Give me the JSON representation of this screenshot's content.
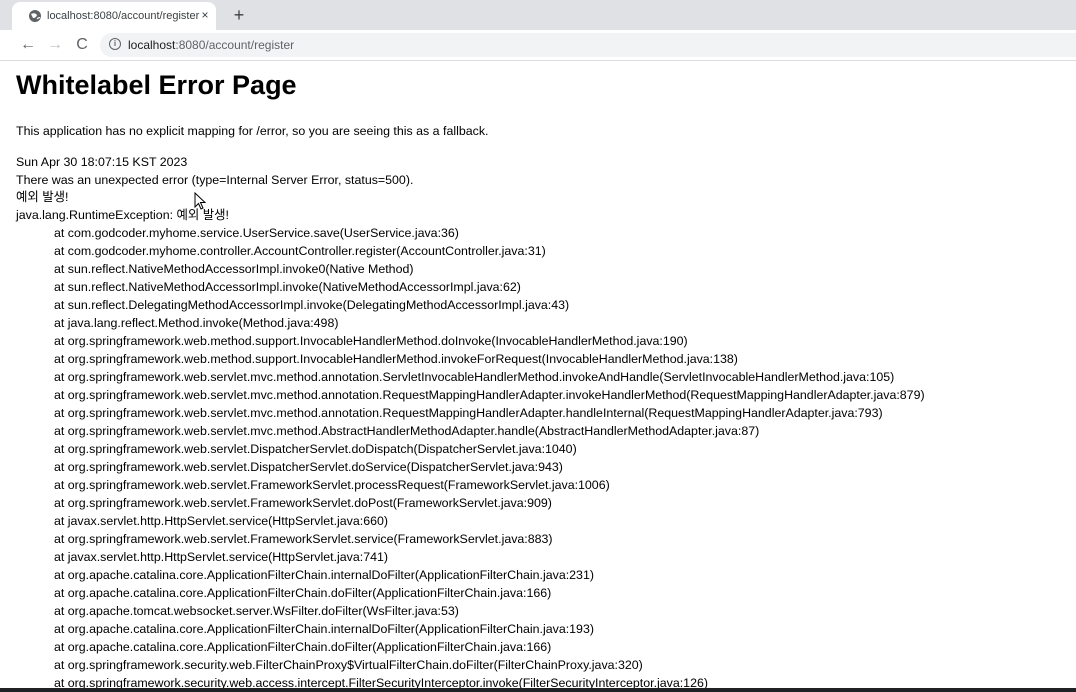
{
  "browser": {
    "tab_title": "localhost:8080/account/register",
    "tab_close": "×",
    "new_tab": "+",
    "back": "←",
    "forward": "→",
    "reload": "C",
    "url_host": "localhost",
    "url_path": ":8080/account/register"
  },
  "page": {
    "title": "Whitelabel Error Page",
    "fallback_msg": "This application has no explicit mapping for /error, so you are seeing this as a fallback.",
    "timestamp": "Sun Apr 30 18:07:15 KST 2023",
    "error_msg": "There was an unexpected error (type=Internal Server Error, status=500).",
    "korean_msg": "예외 발생!",
    "exception": "java.lang.RuntimeException: 예외 발생!",
    "stack_frames": [
      "at com.godcoder.myhome.service.UserService.save(UserService.java:36)",
      "at com.godcoder.myhome.controller.AccountController.register(AccountController.java:31)",
      "at sun.reflect.NativeMethodAccessorImpl.invoke0(Native Method)",
      "at sun.reflect.NativeMethodAccessorImpl.invoke(NativeMethodAccessorImpl.java:62)",
      "at sun.reflect.DelegatingMethodAccessorImpl.invoke(DelegatingMethodAccessorImpl.java:43)",
      "at java.lang.reflect.Method.invoke(Method.java:498)",
      "at org.springframework.web.method.support.InvocableHandlerMethod.doInvoke(InvocableHandlerMethod.java:190)",
      "at org.springframework.web.method.support.InvocableHandlerMethod.invokeForRequest(InvocableHandlerMethod.java:138)",
      "at org.springframework.web.servlet.mvc.method.annotation.ServletInvocableHandlerMethod.invokeAndHandle(ServletInvocableHandlerMethod.java:105)",
      "at org.springframework.web.servlet.mvc.method.annotation.RequestMappingHandlerAdapter.invokeHandlerMethod(RequestMappingHandlerAdapter.java:879)",
      "at org.springframework.web.servlet.mvc.method.annotation.RequestMappingHandlerAdapter.handleInternal(RequestMappingHandlerAdapter.java:793)",
      "at org.springframework.web.servlet.mvc.method.AbstractHandlerMethodAdapter.handle(AbstractHandlerMethodAdapter.java:87)",
      "at org.springframework.web.servlet.DispatcherServlet.doDispatch(DispatcherServlet.java:1040)",
      "at org.springframework.web.servlet.DispatcherServlet.doService(DispatcherServlet.java:943)",
      "at org.springframework.web.servlet.FrameworkServlet.processRequest(FrameworkServlet.java:1006)",
      "at org.springframework.web.servlet.FrameworkServlet.doPost(FrameworkServlet.java:909)",
      "at javax.servlet.http.HttpServlet.service(HttpServlet.java:660)",
      "at org.springframework.web.servlet.FrameworkServlet.service(FrameworkServlet.java:883)",
      "at javax.servlet.http.HttpServlet.service(HttpServlet.java:741)",
      "at org.apache.catalina.core.ApplicationFilterChain.internalDoFilter(ApplicationFilterChain.java:231)",
      "at org.apache.catalina.core.ApplicationFilterChain.doFilter(ApplicationFilterChain.java:166)",
      "at org.apache.tomcat.websocket.server.WsFilter.doFilter(WsFilter.java:53)",
      "at org.apache.catalina.core.ApplicationFilterChain.internalDoFilter(ApplicationFilterChain.java:193)",
      "at org.apache.catalina.core.ApplicationFilterChain.doFilter(ApplicationFilterChain.java:166)",
      "at org.springframework.security.web.FilterChainProxy$VirtualFilterChain.doFilter(FilterChainProxy.java:320)",
      "at org.springframework.security.web.access.intercept.FilterSecurityInterceptor.invoke(FilterSecurityInterceptor.java:126)"
    ]
  }
}
